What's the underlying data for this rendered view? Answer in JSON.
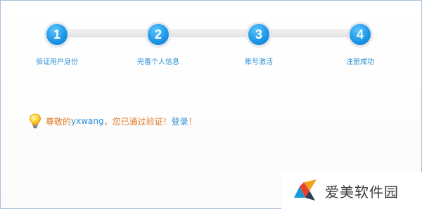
{
  "steps": [
    {
      "number": "1",
      "label": "验证用户身份"
    },
    {
      "number": "2",
      "label": "完善个人信息"
    },
    {
      "number": "3",
      "label": "账号激活"
    },
    {
      "number": "4",
      "label": "注册成功"
    }
  ],
  "message": {
    "prefix": "尊敬的",
    "username": "yxwang",
    "middle": "，您已通过验证！",
    "login_link": "登录",
    "suffix": "！",
    "icon": "lightbulb-icon"
  },
  "watermark": {
    "text": "爱美软件园",
    "icon": "brand-logo"
  },
  "colors": {
    "accent": "#2a8fd6",
    "message": "#e07b2a",
    "step_circle": "#1e98e8"
  }
}
